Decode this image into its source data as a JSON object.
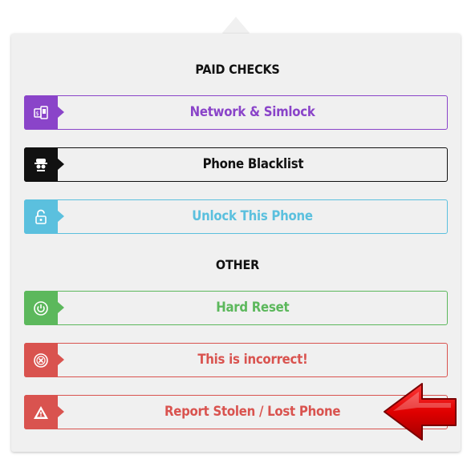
{
  "sections": {
    "paid_title": "PAID CHECKS",
    "other_title": "OTHER"
  },
  "buttons": [
    {
      "label": "Network & Simlock",
      "icon": "sim-card-icon",
      "color": "#8a44c9"
    },
    {
      "label": "Phone Blacklist",
      "icon": "blacklist-spy-icon",
      "color": "#111111"
    },
    {
      "label": "Unlock This Phone",
      "icon": "unlock-padlock-icon",
      "color": "#5bc0de"
    },
    {
      "label": "Hard Reset",
      "icon": "power-reset-icon",
      "color": "#5cb85c"
    },
    {
      "label": "This is incorrect!",
      "icon": "error-x-circle-icon",
      "color": "#d9534f"
    },
    {
      "label": "Report Stolen / Lost Phone",
      "icon": "warning-triangle-icon",
      "color": "#d9534f"
    }
  ],
  "annotation": {
    "icon": "red-arrow-pointer-icon",
    "color": "#cc0000"
  }
}
